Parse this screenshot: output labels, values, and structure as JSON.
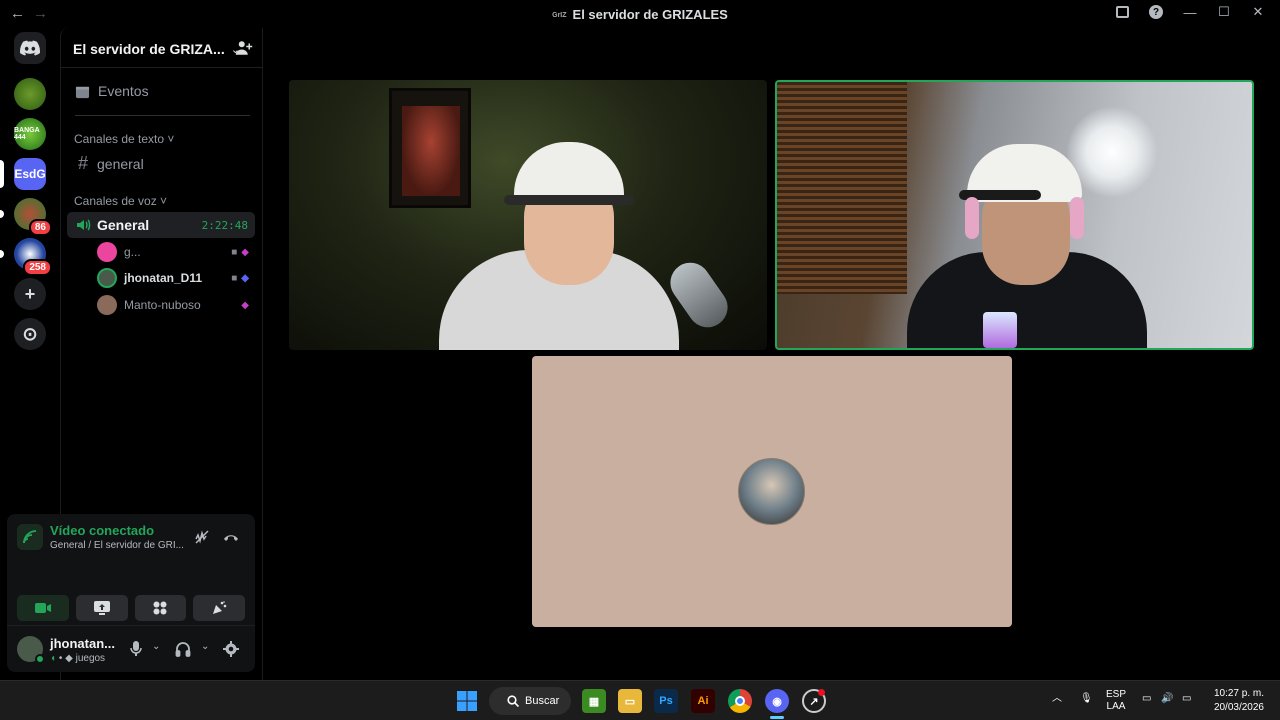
{
  "window": {
    "title": "El servidor de GRIZALES",
    "server_glyph": "GrIZ",
    "back": "←",
    "forward": "→",
    "help": "?",
    "minimize": "—",
    "maximize": "☐",
    "close": "✕"
  },
  "rail": {
    "servers": [
      {
        "label": "",
        "badge": ""
      },
      {
        "label": "BANGA 444",
        "badge": ""
      },
      {
        "label": "EsdG",
        "badge": ""
      },
      {
        "label": "",
        "badge": "86"
      },
      {
        "label": "",
        "badge": "258"
      }
    ],
    "add_label": "+",
    "discover_label": "⊙"
  },
  "sidebar": {
    "guild_name": "El servidor de GRIZA...",
    "events_label": "Eventos",
    "text_category": "Canales de texto ˅",
    "text_channel": "general",
    "voice_category": "Canales de voz ˅",
    "voice_channel": {
      "name": "General",
      "timer": "2:22:48"
    },
    "voice_users": [
      {
        "name": "g...",
        "avatar_color": "#eb459e"
      },
      {
        "name": "jhonatan_D11",
        "avatar_color": "#4a5a4a"
      },
      {
        "name": "Manto-nuboso",
        "avatar_color": "#8a6a5a"
      }
    ]
  },
  "rtc": {
    "status": "Vídeo conectado",
    "location": "General / El servidor de GRI..."
  },
  "user": {
    "name": "jhonatan...",
    "activity": "juegos"
  },
  "taskbar": {
    "search_label": "Buscar",
    "lang_top": "ESP",
    "lang_bottom": "LAA",
    "time": "10:27 p. m.",
    "date": "20/03/2026"
  },
  "colors": {
    "accent_green": "#23a55a",
    "blurple": "#5865f2",
    "tile3_bg": "#c9afa0"
  }
}
